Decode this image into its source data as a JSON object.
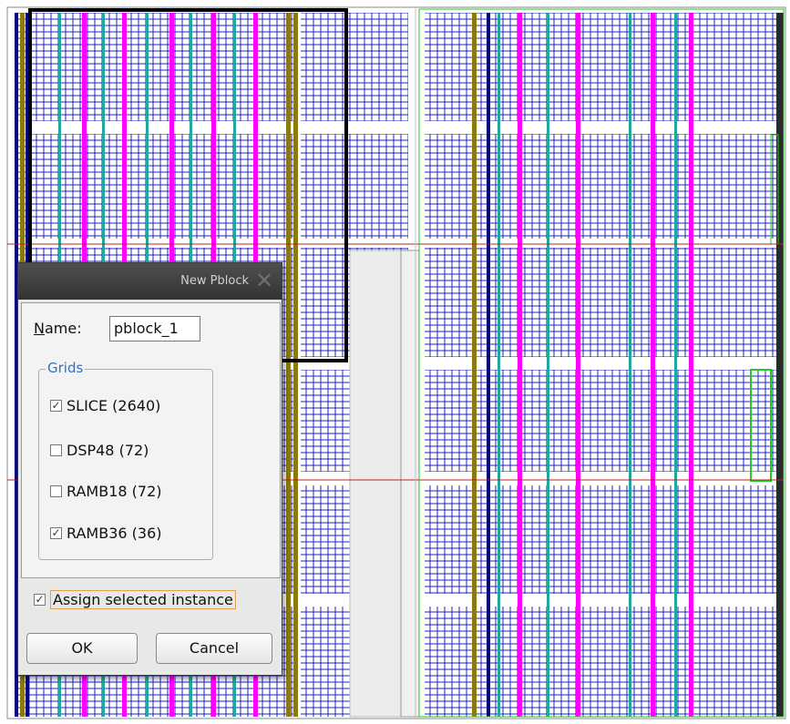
{
  "device_view": {
    "colors": {
      "background": "#ffffff",
      "clb_grid": "#2020c8",
      "dsp_column": "#ff00ff",
      "bram_column": "#20a8a0",
      "clock_column": "#8a7a10",
      "io_column": "#000080",
      "gray_region": "#ececec",
      "pblock_outline": "#000000",
      "region_outline": "#c02020",
      "green_outline": "#22cc22"
    }
  },
  "dialog": {
    "title": "New Pblock",
    "close_icon": "close-icon",
    "name_label": "Name:",
    "name_value": "pblock_1",
    "grids_label": "Grids",
    "grids": [
      {
        "label": "SLICE (2640)",
        "checked": true
      },
      {
        "label": "DSP48 (72)",
        "checked": false
      },
      {
        "label": "RAMB18 (72)",
        "checked": false
      },
      {
        "label": "RAMB36 (36)",
        "checked": true
      }
    ],
    "assign_label": "Assign selected instance",
    "assign_checked": true,
    "ok_label": "OK",
    "cancel_label": "Cancel"
  }
}
